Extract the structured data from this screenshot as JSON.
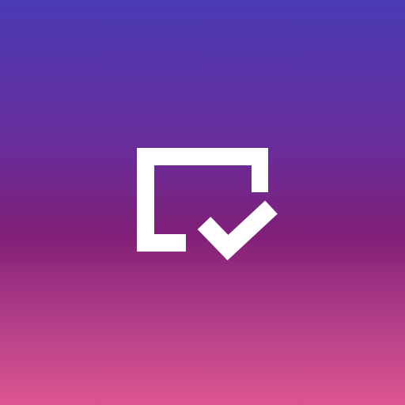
{
  "app_icon": {
    "glyph": "window-check-icon",
    "colors": {
      "gradient_top": "#4a3bb5",
      "gradient_mid_upper": "#6a2c98",
      "gradient_mid": "#801f78",
      "gradient_mid_lower": "#b03d87",
      "gradient_bottom": "#dd5590",
      "glyph_fill": "#ffffff"
    }
  }
}
